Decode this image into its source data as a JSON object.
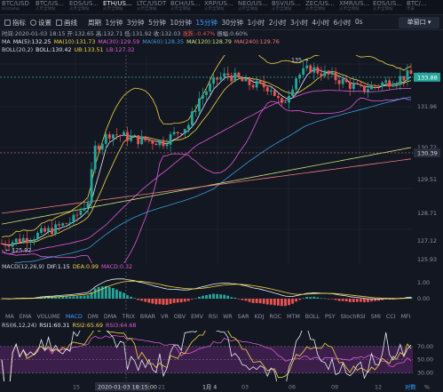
{
  "tickers": [
    {
      "pair": "BTC/USD",
      "sub": "bitstamp"
    },
    {
      "pair": "BTC/US...",
      "sub": "火币全球站"
    },
    {
      "pair": "EOS/US...",
      "sub": "火币全球站"
    },
    {
      "pair": "ETH/US...",
      "sub": "火币全球站",
      "active": true
    },
    {
      "pair": "LTC/USDT",
      "sub": "火币全球站"
    },
    {
      "pair": "BCH/US...",
      "sub": "火币全球站"
    },
    {
      "pair": "XRP/US...",
      "sub": "火币全球站"
    },
    {
      "pair": "NEO/US...",
      "sub": "火币全球站"
    },
    {
      "pair": "BSV/US...",
      "sub": "火币全球站"
    },
    {
      "pair": "ZEC/US...",
      "sub": "火币全球站"
    },
    {
      "pair": "XMR/US...",
      "sub": "火币全球站"
    },
    {
      "pair": "EOS/US...",
      "sub": "火币全球站"
    },
    {
      "pair": "BTC/...",
      "sub": "币安"
    }
  ],
  "toolbar": {
    "indicators": "指标",
    "settings": "设置",
    "draw": "画线",
    "period": "周期",
    "periods": [
      "1分钟",
      "3分钟",
      "5分钟",
      "10分钟",
      "15分钟",
      "30分钟",
      "1小时",
      "2小时",
      "3小时",
      "4小时",
      "6小时",
      "0s"
    ],
    "active_period": "15分钟",
    "chart_mode": "单窗口"
  },
  "ohlc": {
    "time": "时间:2020-01-03 18:15",
    "open": "开:132.65",
    "high": "高:132.71",
    "low": "低:131.92",
    "close": "收:132.03",
    "change": "涨跌:-0.47%",
    "amplitude": "振幅:0.60%"
  },
  "ma_legend": [
    {
      "label": "MA",
      "color": "#c9cfdb"
    },
    {
      "label": "MA(5):132.25",
      "color": "#e8ecf3"
    },
    {
      "label": "MA(10):131.73",
      "color": "#f5d442"
    },
    {
      "label": "MA(30):129.59",
      "color": "#e05ad6"
    },
    {
      "label": "MA(60):128.35",
      "color": "#3a9ad9"
    },
    {
      "label": "MA(120):128.79",
      "color": "#c9e27a"
    },
    {
      "label": "MA(240):129.76",
      "color": "#f07a7a"
    }
  ],
  "boll_legend": [
    {
      "label": "BOLL(20,2)",
      "color": "#c9cfdb"
    },
    {
      "label": "BOLL:130.42",
      "color": "#e8ecf3"
    },
    {
      "label": "UB:133.51",
      "color": "#f5d442"
    },
    {
      "label": "LB:127.32",
      "color": "#e05ad6"
    }
  ],
  "price_axis": [
    "133.20",
    "131.96",
    "130.72",
    "129.51",
    "128.71",
    "127.12",
    "125.93"
  ],
  "price_tags": {
    "current": "133.88",
    "dashed": "130.39",
    "high_marker": "135",
    "low_marker": "125.92"
  },
  "macd_legend": [
    {
      "label": "MACD(12,26,9)",
      "color": "#c9cfdb"
    },
    {
      "label": "DIF:1.15",
      "color": "#e8ecf3"
    },
    {
      "label": "DEA:0.99",
      "color": "#f5d442"
    },
    {
      "label": "MACD:0.32",
      "color": "#e05ad6"
    }
  ],
  "macd_axis": [
    "1.00",
    "0.00"
  ],
  "indicator_tabs": [
    "MA",
    "EMA",
    "VOLUME",
    "MACD",
    "DMI",
    "DMA",
    "TRIX",
    "BRAR",
    "VR",
    "OBV",
    "EMV",
    "RSI",
    "WR",
    "SAR",
    "KDJ",
    "ROC",
    "MTM",
    "BOLL",
    "PSY",
    "StochRSI",
    "SMI",
    "CCI",
    "MFI"
  ],
  "active_indicator": "MACD",
  "rsi_legend": [
    {
      "label": "RSI(6,12,24)",
      "color": "#c9cfdb"
    },
    {
      "label": "RSI1:60.31",
      "color": "#e8ecf3"
    },
    {
      "label": "RSI2:65.69",
      "color": "#f5d442"
    },
    {
      "label": "RSI3:64.68",
      "color": "#e05ad6"
    }
  ],
  "rsi_axis": [
    "70.00",
    "50.00",
    "30.00"
  ],
  "time_axis": {
    "labels": [
      "15",
      "18",
      "21",
      "1月 4",
      "03",
      "06",
      "09",
      "12"
    ],
    "cursor": "2020-01-03 18:15:00",
    "right_label": "对数",
    "pct": "%"
  },
  "colors": {
    "up": "#26a69a",
    "down": "#ef5350",
    "accent": "#3aa0ff"
  }
}
